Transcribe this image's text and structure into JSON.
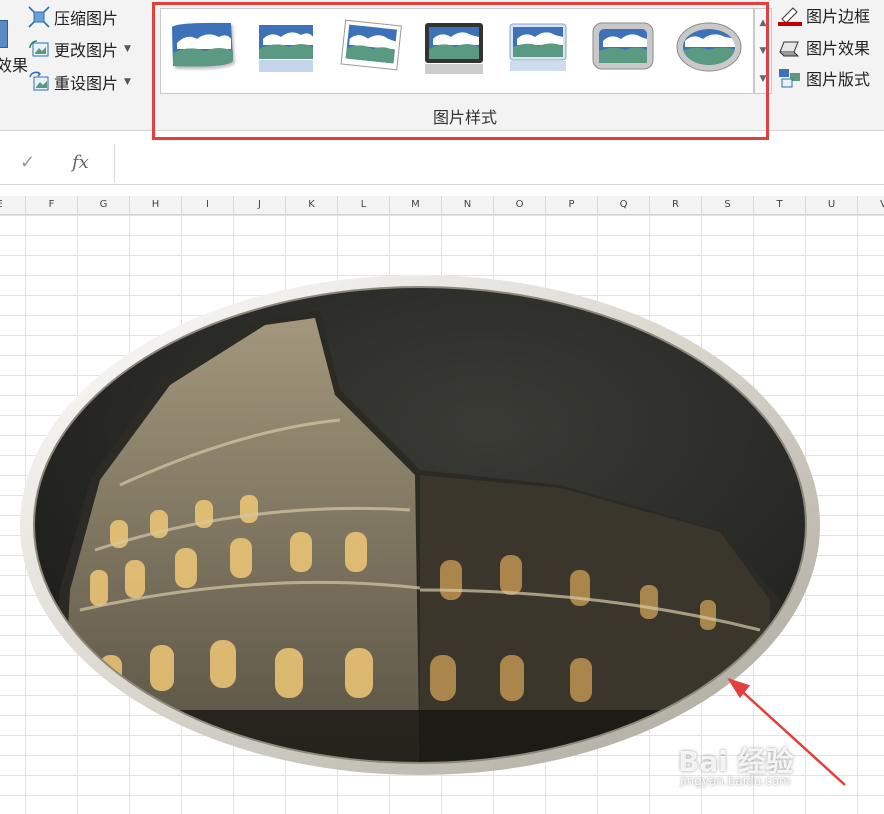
{
  "ribbon": {
    "left_commands": [
      {
        "label": "压缩图片",
        "icon": "compress-picture-icon",
        "dropdown": false
      },
      {
        "label": "更改图片",
        "icon": "change-picture-icon",
        "dropdown": true
      },
      {
        "label": "重设图片",
        "icon": "reset-picture-icon",
        "dropdown": true
      }
    ],
    "partial_label": "效果",
    "picture_styles": {
      "group_label": "图片样式",
      "styles": [
        "style-soft-edge-rectangle",
        "style-reflected-rounded",
        "style-rotated-white",
        "style-thick-black-frame",
        "style-reflected-bevel",
        "style-metal-rounded",
        "style-metal-oval"
      ]
    },
    "right_commands": [
      {
        "label": "图片边框",
        "icon": "picture-border-icon"
      },
      {
        "label": "图片效果",
        "icon": "picture-effects-icon"
      },
      {
        "label": "图片版式",
        "icon": "picture-layout-icon"
      }
    ]
  },
  "formula_bar": {
    "check_symbol": "✓",
    "fx_symbol": "fx",
    "value": ""
  },
  "columns": [
    "E",
    "F",
    "G",
    "H",
    "I",
    "J",
    "K",
    "L",
    "M",
    "N",
    "O",
    "P",
    "Q",
    "R",
    "S",
    "T",
    "U",
    "V"
  ],
  "watermark": {
    "main": "Bai 经验",
    "sub": "jingyan.baidu.com"
  },
  "colors": {
    "highlight": "#e0403e",
    "arrow": "#e0403e",
    "thumb_sky": "#3d72b8",
    "thumb_hill": "#5a9a82"
  }
}
